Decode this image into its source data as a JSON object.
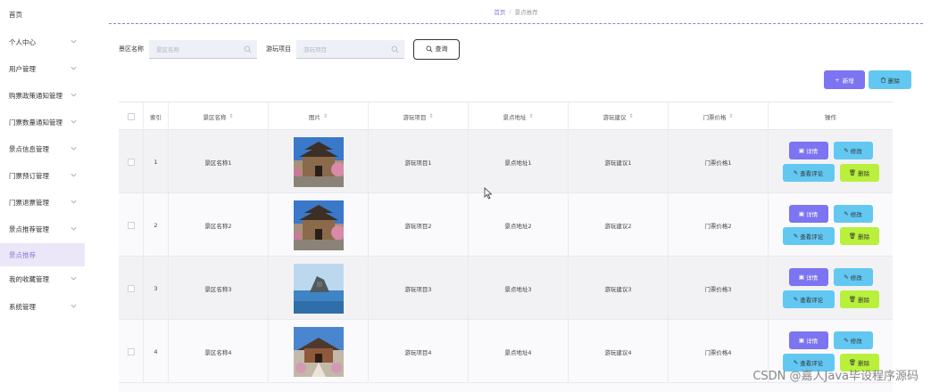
{
  "sidebar": {
    "items": [
      {
        "label": "首页",
        "has_chevron": false,
        "active": false
      },
      {
        "label": "个人中心",
        "has_chevron": true,
        "active": false
      },
      {
        "label": "用户管理",
        "has_chevron": true,
        "active": false
      },
      {
        "label": "购票政策通知管理",
        "has_chevron": true,
        "active": false
      },
      {
        "label": "门票数量通知管理",
        "has_chevron": true,
        "active": false
      },
      {
        "label": "景点信息管理",
        "has_chevron": true,
        "active": false
      },
      {
        "label": "门票预订管理",
        "has_chevron": true,
        "active": false
      },
      {
        "label": "门票退票管理",
        "has_chevron": true,
        "active": false
      },
      {
        "label": "景点推荐管理",
        "has_chevron": true,
        "active": false
      },
      {
        "label": "景点推荐",
        "has_chevron": false,
        "active": true
      },
      {
        "label": "我的收藏管理",
        "has_chevron": true,
        "active": false
      },
      {
        "label": "系统管理",
        "has_chevron": true,
        "active": false
      }
    ]
  },
  "breadcrumb": {
    "home": "首页",
    "separator": "/",
    "current": "景点推荐"
  },
  "search": {
    "name_label": "景区名称",
    "name_placeholder": "景区名称",
    "project_label": "游玩项目",
    "project_placeholder": "游玩项目",
    "query_button": "查询"
  },
  "toolbar": {
    "add_label": "新增",
    "delete_label": "删除"
  },
  "table": {
    "headers": {
      "index": "索引",
      "name": "景区名称",
      "image": "图片",
      "project": "游玩项目",
      "address": "景点地址",
      "suggestion": "游玩建议",
      "price": "门票价格",
      "ops": "操作"
    },
    "rows": [
      {
        "index": "1",
        "name": "景区名称1",
        "image": "pagoda",
        "project": "游玩项目1",
        "address": "景点地址1",
        "suggestion": "游玩建议1",
        "price": "门票价格1"
      },
      {
        "index": "2",
        "name": "景区名称2",
        "image": "pagoda",
        "project": "游玩项目2",
        "address": "景点地址2",
        "suggestion": "游玩建议2",
        "price": "门票价格2"
      },
      {
        "index": "3",
        "name": "景区名称3",
        "image": "lake",
        "project": "游玩项目3",
        "address": "景点地址3",
        "suggestion": "游玩建议3",
        "price": "门票价格3"
      },
      {
        "index": "4",
        "name": "景区名称4",
        "image": "gate",
        "project": "游玩项目4",
        "address": "景点地址4",
        "suggestion": "游玩建议4",
        "price": "门票价格4"
      }
    ],
    "ops": {
      "detail": "详情",
      "edit": "修改",
      "comment": "查看评论",
      "delete": "删除"
    }
  },
  "watermark": "CSDN @嘉人Java毕设程序源码",
  "colors": {
    "accent": "#8f7cd6",
    "primary_button": "#7c74f0",
    "info_button": "#62c8f2",
    "success_button": "#b9f03c",
    "active_sidebar_bg": "#ece7f8"
  }
}
